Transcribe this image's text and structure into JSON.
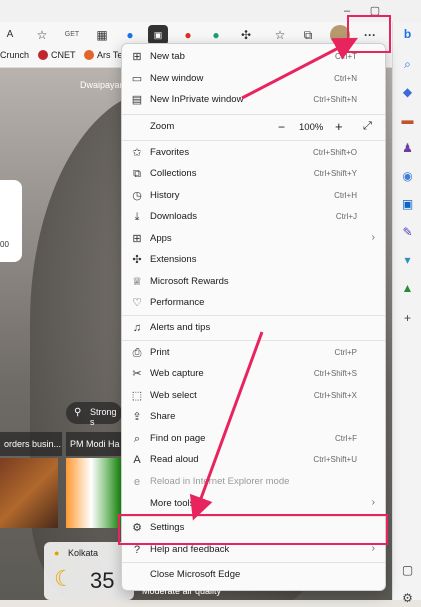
{
  "titlebar": {
    "minimize": "–",
    "maximize": "▢"
  },
  "favorites_bar": [
    {
      "label": "Crunch",
      "color": "#ffffff"
    },
    {
      "label": "CNET",
      "color": "#c0262d"
    },
    {
      "label": "Ars Te",
      "color": "#e3652b"
    }
  ],
  "profile_name": "Dwaipayan",
  "menu": {
    "newtab": {
      "label": "New tab",
      "shortcut": "Ctrl+T"
    },
    "newwindow": {
      "label": "New window",
      "shortcut": "Ctrl+N"
    },
    "inprivate": {
      "label": "New InPrivate window",
      "shortcut": "Ctrl+Shift+N"
    },
    "zoom": {
      "label": "Zoom",
      "value": "100%",
      "minus": "−",
      "plus": "+"
    },
    "favorites": {
      "label": "Favorites",
      "shortcut": "Ctrl+Shift+O"
    },
    "collections": {
      "label": "Collections",
      "shortcut": "Ctrl+Shift+Y"
    },
    "history": {
      "label": "History",
      "shortcut": "Ctrl+H"
    },
    "downloads": {
      "label": "Downloads",
      "shortcut": "Ctrl+J"
    },
    "apps": {
      "label": "Apps"
    },
    "extensions": {
      "label": "Extensions"
    },
    "rewards": {
      "label": "Microsoft Rewards"
    },
    "performance": {
      "label": "Performance"
    },
    "alerts": {
      "label": "Alerts and tips"
    },
    "print": {
      "label": "Print",
      "shortcut": "Ctrl+P"
    },
    "webcapture": {
      "label": "Web capture",
      "shortcut": "Ctrl+Shift+S"
    },
    "webselect": {
      "label": "Web select",
      "shortcut": "Ctrl+Shift+X"
    },
    "share": {
      "label": "Share"
    },
    "find": {
      "label": "Find on page",
      "shortcut": "Ctrl+F"
    },
    "readaloud": {
      "label": "Read aloud",
      "shortcut": "Ctrl+Shift+U"
    },
    "iemode": {
      "label": "Reload in Internet Explorer mode"
    },
    "moretools": {
      "label": "More tools"
    },
    "settings": {
      "label": "Settings"
    },
    "help": {
      "label": "Help and feedback"
    },
    "close": {
      "label": "Close Microsoft Edge"
    }
  },
  "news": {
    "headline1": "orders busin...",
    "headline2": "PM Modi Ha",
    "location_tag": "Strong s"
  },
  "weather": {
    "city": "Kolkata",
    "temp": "35",
    "air": "Moderate air quality"
  },
  "left_card": {
    "value": "00"
  },
  "colors": {
    "highlight": "#e8245f",
    "menu_bg": "#fafafa"
  }
}
